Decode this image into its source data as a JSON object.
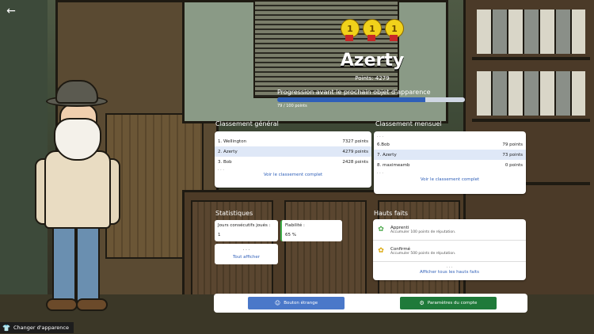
{
  "header": {
    "medals": [
      "1",
      "1",
      "1"
    ],
    "player_name": "Azerty",
    "points_text": "Points: 4279"
  },
  "progress": {
    "title": "Progression avant le prochain objet d'apparence",
    "label": "79 / 100 points",
    "fraction": 0.79
  },
  "general_ranking": {
    "title": "Classement général",
    "rows": [
      {
        "name": "1. Wellington",
        "points": "7327 points",
        "me": false
      },
      {
        "name": "2. Azerty",
        "points": "4279 points",
        "me": true
      },
      {
        "name": "3. Bob",
        "points": "2428 points",
        "me": false
      }
    ],
    "ellipsis": ". . .",
    "link": "Voir le classement complet"
  },
  "monthly_ranking": {
    "title": "Classement mensuel",
    "ellipsis_top": ". . .",
    "rows": [
      {
        "name": "6.Bob",
        "points": "79 points",
        "me": false
      },
      {
        "name": "7. Azerty",
        "points": "73 points",
        "me": true
      },
      {
        "name": "8. maximeamb",
        "points": "0 points",
        "me": false
      }
    ],
    "ellipsis_bottom": ". . .",
    "link": "Voir le classement complet"
  },
  "statistics": {
    "title": "Statistiques",
    "consecutive_label": "Jours consécutifs joués :",
    "consecutive_value": "1",
    "reliability_label": "Fiabilité :",
    "reliability_value": "65 %",
    "more_dots": ". . .",
    "show_all": "Tout afficher"
  },
  "achievements": {
    "title": "Hauts faits",
    "items": [
      {
        "title": "Apprenti",
        "desc": "Accumuler 100 points de réputation.",
        "icon": "laurel-icon"
      },
      {
        "title": "Confirmé",
        "desc": "Accumuler 500 points de réputation.",
        "icon": "laurel-gold-icon"
      }
    ],
    "more_dots": ". . .",
    "show_all": "Afficher tous les hauts faits"
  },
  "buttons": {
    "strange": "Bouton étrange",
    "settings": "Paramètres du compte",
    "change_appearance": "Changer d'apparence"
  },
  "colors": {
    "accent_blue": "#2f5fb8",
    "button_blue": "#4a78c9",
    "button_green": "#1f7a3a",
    "highlight_row": "#dfe8f7",
    "medal_gold": "#f1d21b"
  }
}
